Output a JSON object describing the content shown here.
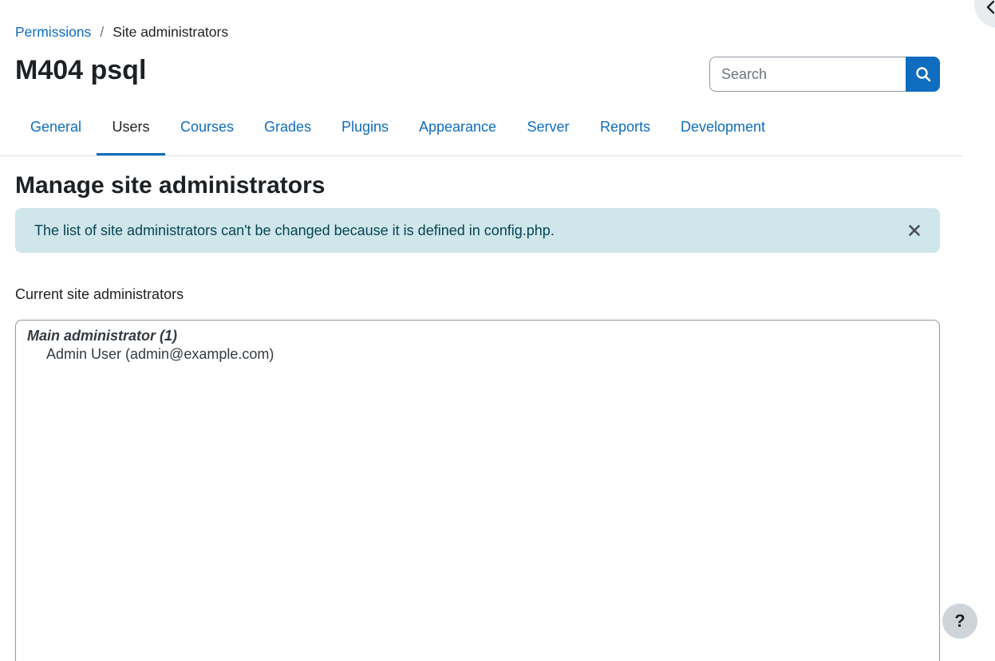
{
  "breadcrumb": {
    "parent": "Permissions",
    "separator": "/",
    "current": "Site administrators"
  },
  "header": {
    "title": "M404 psql"
  },
  "search": {
    "placeholder": "Search",
    "icon": "search-icon"
  },
  "tabs": [
    {
      "label": "General",
      "active": false
    },
    {
      "label": "Users",
      "active": true
    },
    {
      "label": "Courses",
      "active": false
    },
    {
      "label": "Grades",
      "active": false
    },
    {
      "label": "Plugins",
      "active": false
    },
    {
      "label": "Appearance",
      "active": false
    },
    {
      "label": "Server",
      "active": false
    },
    {
      "label": "Reports",
      "active": false
    },
    {
      "label": "Development",
      "active": false
    }
  ],
  "main": {
    "heading": "Manage site administrators",
    "alert": {
      "message": "The list of site administrators can't be changed because it is defined in config.php.",
      "close_icon": "close-icon"
    },
    "list_label": "Current site administrators",
    "list": {
      "group_label": "Main administrator (1)",
      "options": [
        "Admin User (admin@example.com)"
      ]
    }
  },
  "help": {
    "label": "?"
  },
  "colors": {
    "accent": "#0f6cbf",
    "alert_bg": "#cfe6ea",
    "alert_text": "#084554"
  }
}
